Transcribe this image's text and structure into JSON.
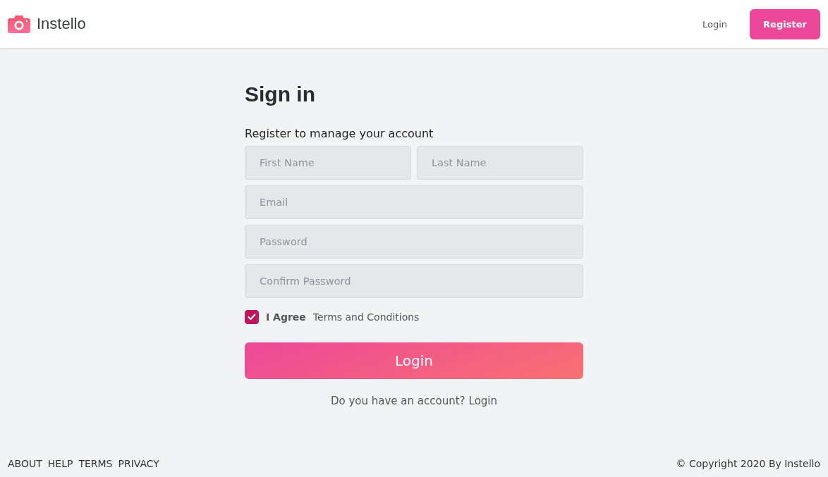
{
  "header": {
    "brand": "Instello",
    "nav": [
      {
        "label": "Login",
        "kind": "link"
      },
      {
        "label": "Register",
        "kind": "primary"
      }
    ]
  },
  "form": {
    "title": "Sign in",
    "subtitle": "Register to manage your account",
    "fields": [
      {
        "placeholder": "First Name",
        "kind": "half"
      },
      {
        "placeholder": "Last Name",
        "kind": "half"
      },
      {
        "placeholder": "Email",
        "kind": "full"
      },
      {
        "placeholder": "Password",
        "kind": "full"
      },
      {
        "placeholder": "Confirm Password",
        "kind": "full"
      }
    ],
    "agree": {
      "checked": true,
      "label": "I Agree",
      "link": "Terms and Conditions"
    },
    "submit": "Login",
    "prompt": "Do you have an account?",
    "prompt_link": "Login"
  },
  "footer": {
    "links": [
      "ABOUT",
      "HELP",
      "TERMS",
      "PRIVACY"
    ],
    "copyright": "© Copyright 2020 By Instello"
  }
}
